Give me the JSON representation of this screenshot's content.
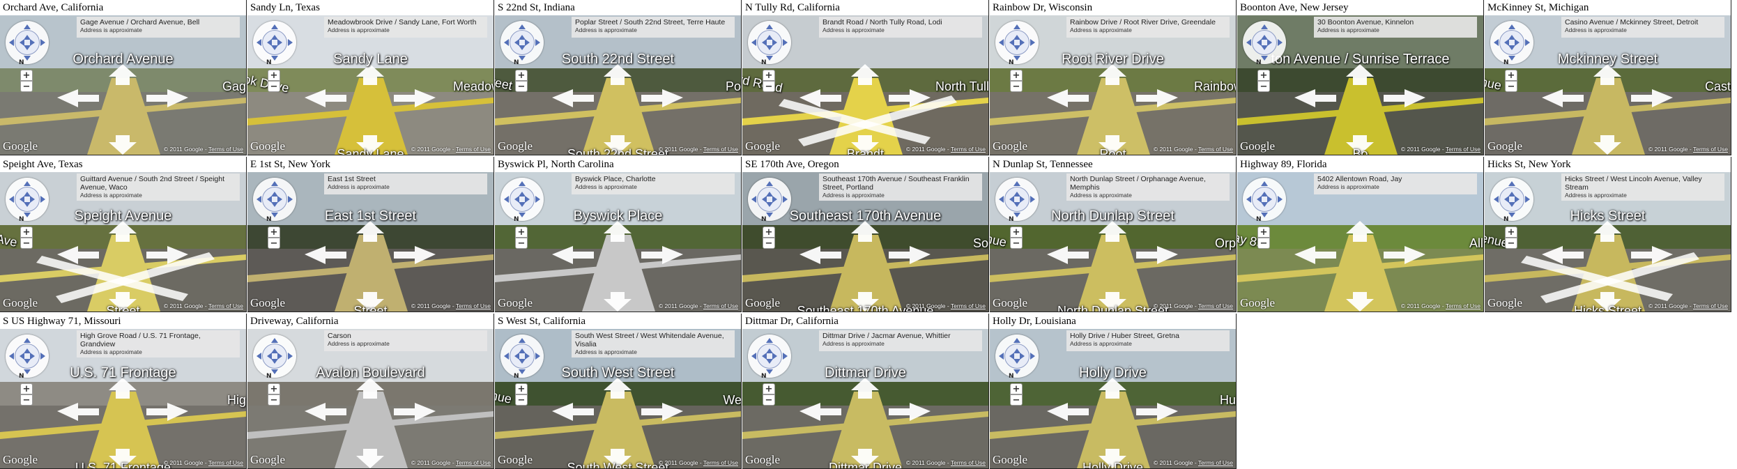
{
  "page": {
    "layout_note_text": "",
    "common": {
      "address_approx": "Address is approximate",
      "copyright": "© 2011 Google",
      "separator": " - ",
      "terms": "Terms of Use",
      "google_logo": "Google",
      "north": "N",
      "zoom_in": "+",
      "zoom_out": "−"
    },
    "tiles": [
      {
        "caption": "Orchard Ave, California",
        "address": "Gage Avenue / Orchard Avenue, Bell",
        "label_main": "Orchard Avenue",
        "label_left": "",
        "label_right": "Gage",
        "label_bottom": "",
        "sky": "#b8c4cc",
        "veg": "#7e8a6c",
        "ground": "#7a7a72",
        "line": "#c9b96a",
        "dir": "bar"
      },
      {
        "caption": "Sandy Ln, Texas",
        "address": "Meadowbrook Drive / Sandy Lane, Fort Worth",
        "label_main": "Sandy Lane",
        "label_left": "ok Drive",
        "label_right": "Meadow",
        "label_bottom": "Sandy Lane",
        "sky": "#d8dde2",
        "veg": "#7f8b5a",
        "ground": "#8d8a80",
        "line": "#d6c03a",
        "dir": "wide"
      },
      {
        "caption": "S 22nd St, Indiana",
        "address": "Poplar Street / South 22nd Street, Terre Haute",
        "label_main": "South 22nd Street",
        "label_left": "reet",
        "label_right": "Pop",
        "label_bottom": "South 22nd Street",
        "sky": "#b4c0c9",
        "veg": "#4e5a3e",
        "ground": "#747068",
        "line": "#d0c060",
        "dir": "wide"
      },
      {
        "caption": "N Tully Rd, California",
        "address": "Brandt Road / North Tully Road, Lodi",
        "label_main": "",
        "label_left": "rd Road",
        "label_right": "North Tully",
        "label_bottom": "Brandt",
        "sky": "#c6ccd0",
        "veg": "#5e6a3e",
        "ground": "#6f6a60",
        "line": "#e4d24a",
        "dir": "x"
      },
      {
        "caption": "Rainbow Dr, Wisconsin",
        "address": "Rainbow Drive / Root River Drive, Greendale",
        "label_main": "Root River Drive",
        "label_left": "",
        "label_right": "Rainbow",
        "label_bottom": "Root",
        "sky": "#d0d6d8",
        "veg": "#6c7a44",
        "ground": "#767268",
        "line": "#cdbf66",
        "dir": "bar"
      },
      {
        "caption": "Boonton Ave, New Jersey",
        "address": "30 Boonton Avenue, Kinnelon",
        "label_main": "ton Avenue / Sunrise Terrace",
        "label_left": "",
        "label_right": "",
        "label_bottom": "Bo",
        "sky": "#6f7c66",
        "veg": "#3d4a30",
        "ground": "#54564c",
        "line": "#c9c02e",
        "dir": "bar"
      },
      {
        "caption": "McKinney St, Michigan",
        "address": "Casino Avenue / Mckinney Street, Detroit",
        "label_main": "Mckinney Street",
        "label_left": "nue",
        "label_right": "Caste",
        "label_bottom": "",
        "sky": "#c2ccd4",
        "veg": "#5b6b3b",
        "ground": "#6e6b65",
        "line": "#c7b862",
        "dir": "wide"
      },
      {
        "caption": "Speight Ave, Texas",
        "address": "Guittard Avenue / South 2nd Street / Speight Avenue, Waco",
        "label_main": "Speight Avenue",
        "label_left": "Ave",
        "label_right": "",
        "label_bottom": "Street",
        "sky": "#c9d0d5",
        "veg": "#66713f",
        "ground": "#6c6a62",
        "line": "#d9cc64",
        "dir": "x"
      },
      {
        "caption": "E 1st St, New York",
        "address": "East 1st Street",
        "label_main": "East 1st Street",
        "label_left": "",
        "label_right": "",
        "label_bottom": "Street",
        "sky": "#aab6bd",
        "veg": "#3d4733",
        "ground": "#5d5a56",
        "line": "#c0b070",
        "dir": "bar"
      },
      {
        "caption": "Byswick Pl, North Carolina",
        "address": "Byswick Place, Charlotte",
        "label_main": "Byswick Place",
        "label_left": "",
        "label_right": "",
        "label_bottom": "",
        "sky": "#c8d2d8",
        "veg": "#526636",
        "ground": "#6a6862",
        "line": "#c8c8c8",
        "dir": "bar"
      },
      {
        "caption": "SE 170th Ave, Oregon",
        "address": "Southeast 170th Avenue / Southeast Franklin Street, Portland",
        "label_main": "Southeast 170th Avenue",
        "label_left": "",
        "label_right": "Sou",
        "label_bottom": "Southeast 170th Avenue",
        "sky": "#9aa5ab",
        "veg": "#3f4c2d",
        "ground": "#59574f",
        "line": "#c7b85e",
        "dir": "wide"
      },
      {
        "caption": "N Dunlap St, Tennessee",
        "address": "North Dunlap Street / Orphanage Avenue, Memphis",
        "label_main": "North Dunlap Street",
        "label_left": "nue",
        "label_right": "Orpa",
        "label_bottom": "North Dunlap Street",
        "sky": "#c6ced4",
        "veg": "#52662f",
        "ground": "#6b6962",
        "line": "#ccbe60",
        "dir": "wide"
      },
      {
        "caption": "Highway 89, Florida",
        "address": "5402 Allentown Road, Jay",
        "label_main": "",
        "label_left": "ay 89",
        "label_right": "Alle",
        "label_bottom": "",
        "sky": "#b7c8d6",
        "veg": "#6c8a3c",
        "ground": "#7c8a52",
        "line": "#d3c55c",
        "dir": "bar"
      },
      {
        "caption": "Hicks St, New York",
        "address": "Hicks Street / West Lincoln Avenue, Valley Stream",
        "label_main": "Hicks Street",
        "label_left": "enue",
        "label_right": "",
        "label_bottom": "Hicks Street",
        "sky": "#c7d1d6",
        "veg": "#4f6135",
        "ground": "#6f6d66",
        "line": "#c7b85e",
        "dir": "x"
      },
      {
        "caption": "S US Highway 71, Missouri",
        "address": "High Grove Road / U.S. 71 Frontage, Grandview",
        "label_main": "U.S. 71 Frontage",
        "label_left": "",
        "label_right": "High",
        "label_bottom": "U.S. 71 Frontage",
        "sky": "#d1d7dc",
        "veg": "#8e8b84",
        "ground": "#74716b",
        "line": "#d6c452",
        "dir": "wide"
      },
      {
        "caption": "Driveway, California",
        "address": "Carson",
        "label_main": "Avalon Boulevard",
        "label_left": "",
        "label_right": "",
        "label_bottom": "",
        "sky": "#d6dadd",
        "veg": "#7b776e",
        "ground": "#7c7a73",
        "line": "#c0c0c0",
        "dir": "bar"
      },
      {
        "caption": "S West St, California",
        "address": "South West Street / West Whitendale Avenue, Visalia",
        "label_main": "South West Street",
        "label_left": "nue",
        "label_right": "Wes",
        "label_bottom": "South West Street",
        "sky": "#aebdc8",
        "veg": "#3f5230",
        "ground": "#65635c",
        "line": "#c9bb61",
        "dir": "wide"
      },
      {
        "caption": "Dittmar Dr, California",
        "address": "Dittmar Drive / Jacmar Avenue, Whittier",
        "label_main": "Dittmar Drive",
        "label_left": "",
        "label_right": "",
        "label_bottom": "Dittmar Drive",
        "sky": "#c2ccd2",
        "veg": "#465a31",
        "ground": "#6c6a63",
        "line": "#c8bb62",
        "dir": "wide"
      },
      {
        "caption": "Holly Dr, Louisiana",
        "address": "Holly Drive / Huber Street, Gretna",
        "label_main": "Holly Drive",
        "label_left": "",
        "label_right": "Hub",
        "label_bottom": "Holly Drive",
        "sky": "#b6c3cc",
        "veg": "#4e6436",
        "ground": "#6a6862",
        "line": "#c8bb62",
        "dir": "wide"
      }
    ]
  }
}
